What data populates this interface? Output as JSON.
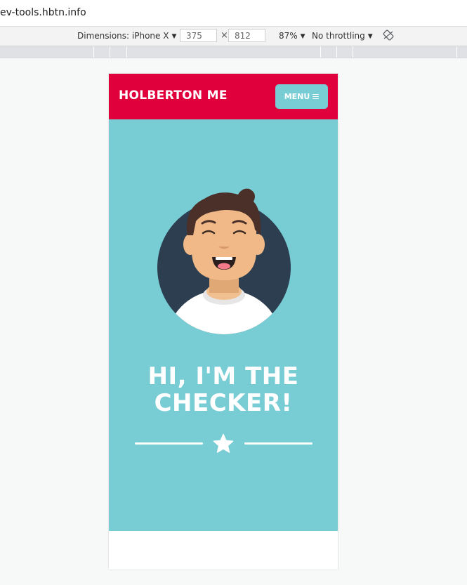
{
  "browser": {
    "url_text": "ev-tools.hbtn.info"
  },
  "device_toolbar": {
    "dimensions_label": "Dimensions: iPhone X",
    "width_value": "375",
    "times_sign": "×",
    "height_value": "812",
    "zoom_label": "87%",
    "throttling_label": "No throttling",
    "caret": "▼",
    "rotate_icon": "rotate-icon"
  },
  "site": {
    "brand": "HOLBERTON ME",
    "menu_label": "MENU",
    "menu_icon": "hamburger-icon",
    "hero_title_line1": "HI, I'M THE",
    "hero_title_line2": "CHECKER!",
    "divider_icon": "star-icon",
    "colors": {
      "header_bg": "#e0003c",
      "accent": "#78cdd4",
      "avatar_bg": "#2c3e50"
    }
  }
}
